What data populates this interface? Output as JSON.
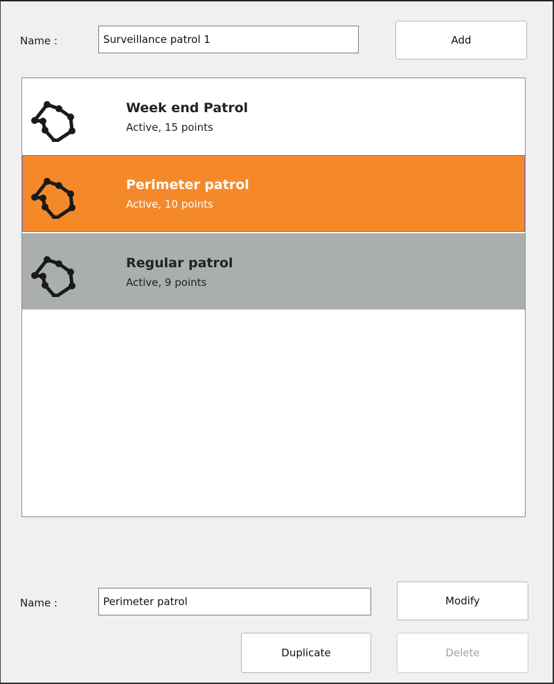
{
  "top": {
    "name_label": "Name :",
    "name_value": "Surveillance patrol 1",
    "add_label": "Add"
  },
  "patrols": [
    {
      "title": "Week end Patrol",
      "subtitle": "Active,  15 points",
      "state": "normal"
    },
    {
      "title": "Perimeter patrol",
      "subtitle": "Active,  10 points",
      "state": "selected"
    },
    {
      "title": "Regular patrol",
      "subtitle": "Active,  9 points",
      "state": "hover"
    }
  ],
  "bottom": {
    "name_label": "Name :",
    "name_value": "Perimeter patrol",
    "modify_label": "Modify",
    "duplicate_label": "Duplicate",
    "delete_label": "Delete"
  },
  "icons": {
    "patrol_route": "patrol-route-icon"
  },
  "colors": {
    "selected_bg": "#f5892a",
    "selected_border": "#9a6a8c",
    "hover_bg": "#aaaeae",
    "normal_bg": "#ffffff",
    "icon_color": "#1a1a1a"
  }
}
